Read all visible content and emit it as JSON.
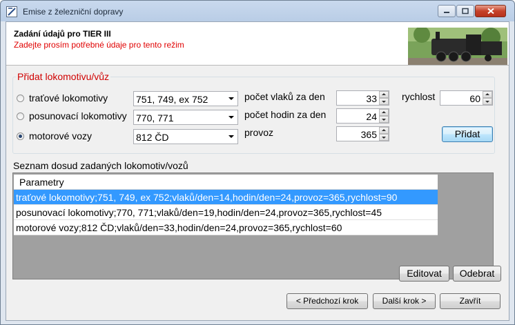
{
  "window": {
    "title": "Emise z železniční dopravy"
  },
  "header": {
    "title": "Zadání údajů pro TIER III",
    "subtitle": "Zadejte prosím potřebné údaje pro tento režim"
  },
  "form": {
    "group_title": "Přidat lokomotivu/vůz",
    "options": [
      {
        "label": "traťové lokomotivy",
        "combo": "751, 749, ex 752",
        "checked": false
      },
      {
        "label": "posunovací lokomotivy",
        "combo": "770, 771",
        "checked": false
      },
      {
        "label": "motorové vozy",
        "combo": "812 ČD",
        "checked": true
      }
    ],
    "trains_label": "počet vlaků za den",
    "trains_value": "33",
    "hours_label": "počet hodin za den",
    "hours_value": "24",
    "operation_label": "provoz",
    "operation_value": "365",
    "speed_label": "rychlost",
    "speed_value": "60",
    "add_button": "Přidat"
  },
  "list": {
    "label": "Seznam dosud zadaných lokomotiv/vozů",
    "header": "Parametry",
    "rows": [
      "traťové lokomotivy;751, 749, ex 752;vlaků/den=14,hodin/den=24,provoz=365,rychlost=90",
      "posunovací lokomotivy;770, 771;vlaků/den=19,hodin/den=24,provoz=365,rychlost=45",
      "motorové vozy;812 ČD;vlaků/den=33,hodin/den=24,provoz=365,rychlost=60"
    ],
    "selected_index": 0
  },
  "actions": {
    "edit": "Editovat",
    "remove": "Odebrat",
    "prev": "< Předchozí krok",
    "next": "Další krok >",
    "close": "Zavřít"
  },
  "icons": [
    "app-icon",
    "minimize-icon",
    "maximize-icon",
    "close-icon",
    "locomotive-image"
  ],
  "colors": {
    "accent_red": "#d00000",
    "selection_blue": "#3399ff"
  }
}
